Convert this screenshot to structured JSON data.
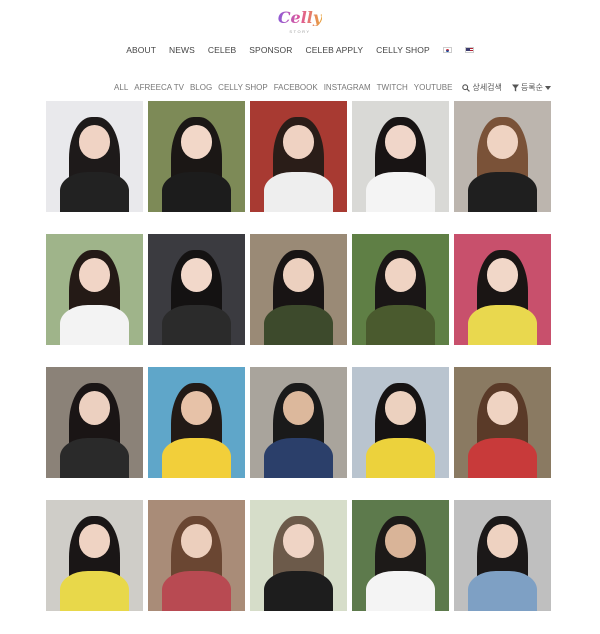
{
  "brand": {
    "logo_text": "Celly",
    "logo_sub": "STORY"
  },
  "main_nav": [
    {
      "label": "ABOUT"
    },
    {
      "label": "NEWS"
    },
    {
      "label": "CELEB"
    },
    {
      "label": "SPONSOR"
    },
    {
      "label": "CELEB APPLY"
    },
    {
      "label": "CELLY SHOP"
    }
  ],
  "languages": [
    "flag-kr-icon",
    "flag-us-icon"
  ],
  "categories": [
    {
      "label": "ALL"
    },
    {
      "label": "AFREECA TV"
    },
    {
      "label": "BLOG"
    },
    {
      "label": "CELLY SHOP"
    },
    {
      "label": "FACEBOOK"
    },
    {
      "label": "INSTAGRAM"
    },
    {
      "label": "TWITCH"
    },
    {
      "label": "YOUTUBE"
    }
  ],
  "tools": {
    "search_label": "상세검색",
    "sort_label": "등록순",
    "search_icon": "search-icon",
    "filter_icon": "filter-icon",
    "caret_icon": "caret-down-icon"
  },
  "colors": {
    "nav_text": "#444444",
    "category_text": "#777777",
    "logo_gradient": [
      "#8e5bd6",
      "#e0569a",
      "#e8a23a"
    ]
  },
  "celebs": [
    {
      "bg": "#e9e9ec",
      "hair": "#1e1a1a",
      "face": "#f0d3c4",
      "top": "#222222"
    },
    {
      "bg": "#7d8a57",
      "hair": "#1b1715",
      "face": "#f2d7c8",
      "top": "#1c1c1c"
    },
    {
      "bg": "#a83a32",
      "hair": "#2a1d18",
      "face": "#efd2c2",
      "top": "#eeeeee"
    },
    {
      "bg": "#d9d9d6",
      "hair": "#181414",
      "face": "#f0d6c9",
      "top": "#f4f4f4"
    },
    {
      "bg": "#bcb5ae",
      "hair": "#7a5238",
      "face": "#efd3c2",
      "top": "#1f1f1f"
    },
    {
      "bg": "#9fb48a",
      "hair": "#241a16",
      "face": "#f1d5c6",
      "top": "#f3f3f3"
    },
    {
      "bg": "#3b3b40",
      "hair": "#141212",
      "face": "#f2d8ca",
      "top": "#2b2b2b"
    },
    {
      "bg": "#9a8a76",
      "hair": "#181414",
      "face": "#ecd0bf",
      "top": "#3d4a2c"
    },
    {
      "bg": "#5f7f45",
      "hair": "#1a1616",
      "face": "#efd3c3",
      "top": "#4a5a2e"
    },
    {
      "bg": "#c8506c",
      "hair": "#1a1514",
      "face": "#f1d7c8",
      "top": "#e9d84e"
    },
    {
      "bg": "#8b8278",
      "hair": "#1a1515",
      "face": "#ecd0c0",
      "top": "#2a2a2a"
    },
    {
      "bg": "#5fa6c9",
      "hair": "#221a16",
      "face": "#e7c2a8",
      "top": "#f2cf3a"
    },
    {
      "bg": "#a9a49c",
      "hair": "#1a1a1a",
      "face": "#dcb89c",
      "top": "#2b3f6a"
    },
    {
      "bg": "#b9c4cf",
      "hair": "#161313",
      "face": "#ecd1bf",
      "top": "#ecd23c"
    },
    {
      "bg": "#8a7a62",
      "hair": "#5a3a28",
      "face": "#efd3c2",
      "top": "#c83a3a"
    },
    {
      "bg": "#cfcdc8",
      "hair": "#1a1616",
      "face": "#efd3c3",
      "top": "#e8d84a"
    },
    {
      "bg": "#a98c78",
      "hair": "#6a4632",
      "face": "#eccfbd",
      "top": "#b84a52"
    },
    {
      "bg": "#d6ddc9",
      "hair": "#6c5a4a",
      "face": "#efd4c5",
      "top": "#1d1d1d"
    },
    {
      "bg": "#5d7a4c",
      "hair": "#1d1a18",
      "face": "#d9b498",
      "top": "#f4f4f4"
    },
    {
      "bg": "#bfbfbf",
      "hair": "#1b1818",
      "face": "#eed2c1",
      "top": "#7ea0c4"
    }
  ]
}
